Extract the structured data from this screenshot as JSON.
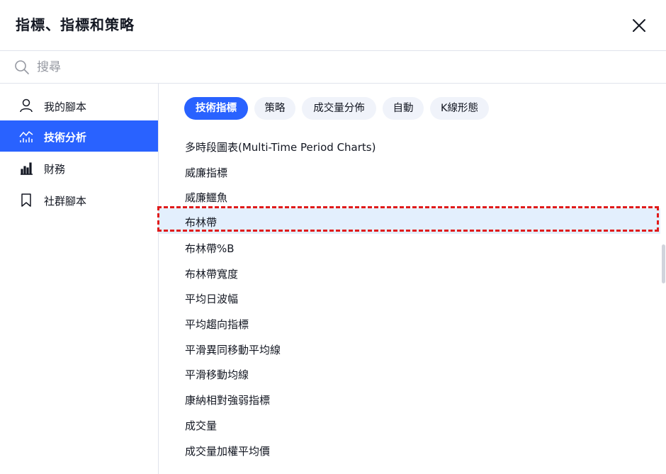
{
  "header": {
    "title": "指標、指標和策略"
  },
  "search": {
    "placeholder": "搜尋",
    "value": ""
  },
  "sidebar": {
    "items": [
      {
        "label": "我的腳本",
        "icon": "user-icon",
        "active": false
      },
      {
        "label": "技術分析",
        "icon": "chart-line-icon",
        "active": true
      },
      {
        "label": "財務",
        "icon": "bar-chart-icon",
        "active": false
      },
      {
        "label": "社群腳本",
        "icon": "bookmark-icon",
        "active": false
      }
    ]
  },
  "tabs": [
    {
      "label": "技術指標",
      "active": true
    },
    {
      "label": "策略",
      "active": false
    },
    {
      "label": "成交量分佈",
      "active": false
    },
    {
      "label": "自動",
      "active": false
    },
    {
      "label": "K線形態",
      "active": false
    }
  ],
  "list": {
    "items": [
      "多時段圖表(Multi-Time Period Charts)",
      "威廉指標",
      "威廉鱷魚",
      "布林帶",
      "布林帶%B",
      "布林帶寬度",
      "平均日波幅",
      "平均趨向指標",
      "平滑異同移動平均線",
      "平滑移動均線",
      "康納相對強弱指標",
      "成交量",
      "成交量加權平均價"
    ],
    "selected_index": 3
  },
  "colors": {
    "accent": "#2962ff",
    "highlight": "#e01b1b",
    "selected_row": "#e3effd"
  }
}
